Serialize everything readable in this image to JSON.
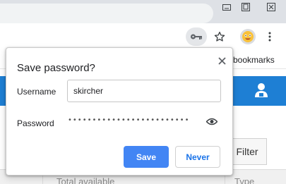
{
  "browser": {
    "window_controls": {
      "minimize_icon": "minimize-icon",
      "restore_icon": "restore-icon",
      "close_icon": "close-icon"
    },
    "toolbar": {
      "key_icon": "key-icon",
      "star_icon": "star-icon",
      "avatar_icon": "emoji-avatar-icon",
      "menu_icon": "kebab-menu-icon"
    },
    "bookmarks_label": "bookmarks"
  },
  "page": {
    "accent_color": "#1e7fd4",
    "filter_label": "Filter",
    "column_total": "Total available",
    "column_type": "Type"
  },
  "dialog": {
    "title": "Save password?",
    "username_label": "Username",
    "username_value": "skircher",
    "password_label": "Password",
    "password_value": "•••••••••••••••••••••••••",
    "save_label": "Save",
    "never_label": "Never",
    "save_color": "#4285f4",
    "never_color": "#1a73e8"
  }
}
